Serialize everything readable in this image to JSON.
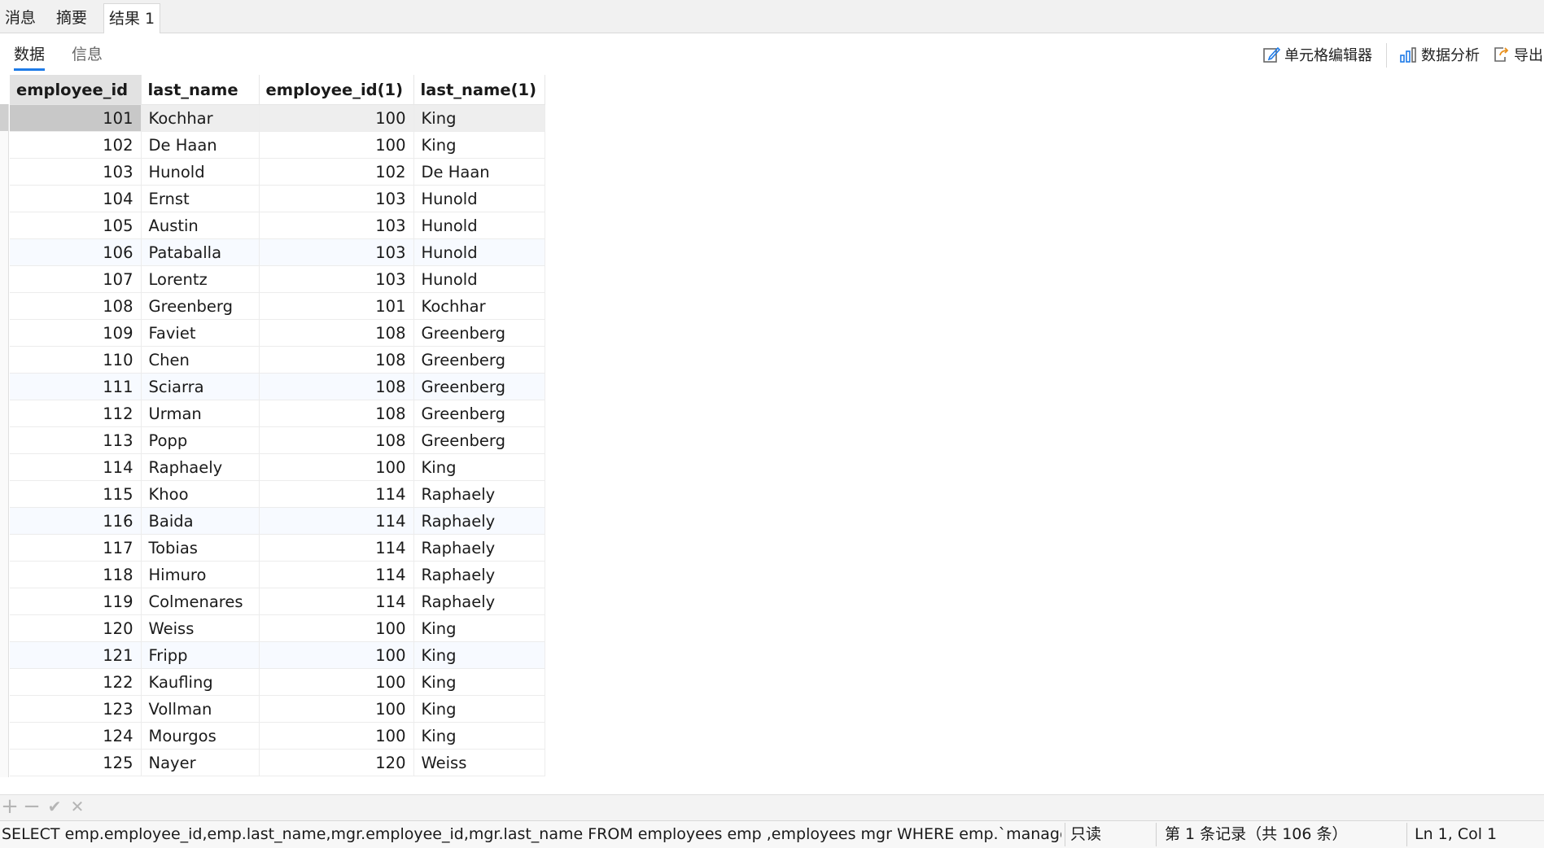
{
  "top_tabs": [
    "消息",
    "摘要",
    "结果 1"
  ],
  "sub_tabs": [
    "数据",
    "信息"
  ],
  "toolbar": {
    "cell_editor_label": "单元格编辑器",
    "data_analysis_label": "数据分析",
    "export_label": "导出"
  },
  "columns": [
    "employee_id",
    "last_name",
    "employee_id(1)",
    "last_name(1)"
  ],
  "rows": [
    [
      "101",
      "Kochhar",
      "100",
      "King"
    ],
    [
      "102",
      "De Haan",
      "100",
      "King"
    ],
    [
      "103",
      "Hunold",
      "102",
      "De Haan"
    ],
    [
      "104",
      "Ernst",
      "103",
      "Hunold"
    ],
    [
      "105",
      "Austin",
      "103",
      "Hunold"
    ],
    [
      "106",
      "Pataballa",
      "103",
      "Hunold"
    ],
    [
      "107",
      "Lorentz",
      "103",
      "Hunold"
    ],
    [
      "108",
      "Greenberg",
      "101",
      "Kochhar"
    ],
    [
      "109",
      "Faviet",
      "108",
      "Greenberg"
    ],
    [
      "110",
      "Chen",
      "108",
      "Greenberg"
    ],
    [
      "111",
      "Sciarra",
      "108",
      "Greenberg"
    ],
    [
      "112",
      "Urman",
      "108",
      "Greenberg"
    ],
    [
      "113",
      "Popp",
      "108",
      "Greenberg"
    ],
    [
      "114",
      "Raphaely",
      "100",
      "King"
    ],
    [
      "115",
      "Khoo",
      "114",
      "Raphaely"
    ],
    [
      "116",
      "Baida",
      "114",
      "Raphaely"
    ],
    [
      "117",
      "Tobias",
      "114",
      "Raphaely"
    ],
    [
      "118",
      "Himuro",
      "114",
      "Raphaely"
    ],
    [
      "119",
      "Colmenares",
      "114",
      "Raphaely"
    ],
    [
      "120",
      "Weiss",
      "100",
      "King"
    ],
    [
      "121",
      "Fripp",
      "100",
      "King"
    ],
    [
      "122",
      "Kaufling",
      "100",
      "King"
    ],
    [
      "123",
      "Vollman",
      "100",
      "King"
    ],
    [
      "124",
      "Mourgos",
      "100",
      "King"
    ],
    [
      "125",
      "Nayer",
      "120",
      "Weiss"
    ]
  ],
  "edit_bar": {
    "add": "+",
    "remove": "−",
    "apply": "✔",
    "discard": "✕"
  },
  "status": {
    "sql": "SELECT emp.employee_id,emp.last_name,mgr.employee_id,mgr.last_name FROM employees emp ,employees mgr WHERE emp.`manager_id` = mgr.`em",
    "mode": "只读",
    "record": "第 1 条记录（共 106 条）",
    "cursor": "Ln 1, Col 1"
  },
  "colors": {
    "accent": "#1e7be8",
    "selected_cell": "#c8c8c8"
  }
}
